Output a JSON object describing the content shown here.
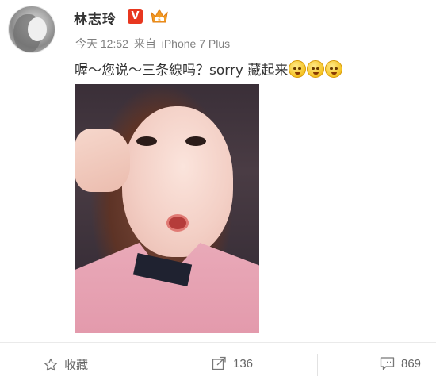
{
  "post": {
    "author": "林志玲",
    "verified_badge": "V",
    "time": "今天 12:52",
    "source_prefix": "来自",
    "source": "iPhone 7 Plus",
    "text": "喔～您说～三条線吗？sorry 藏起来",
    "emojis": [
      "blush-emoji-icon",
      "shy-emoji-icon",
      "tearful-emoji-icon"
    ],
    "image": "selfie-photo"
  },
  "actions": {
    "favorite_label": "收藏",
    "share_count": "136",
    "comment_count": "869"
  },
  "colors": {
    "badge_red": "#e8371f",
    "meta_gray": "#808080",
    "text": "#333333"
  }
}
